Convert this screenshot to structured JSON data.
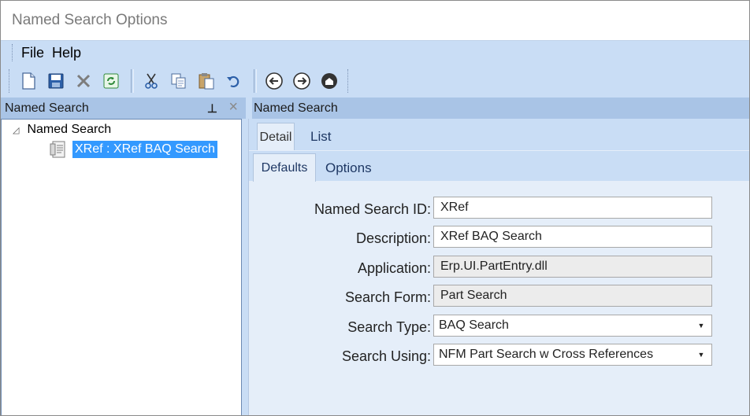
{
  "window": {
    "title": "Named Search Options"
  },
  "menu": {
    "file": "File",
    "help": "Help"
  },
  "toolbar": {
    "buttons": [
      {
        "name": "new",
        "icon": "new-document-icon"
      },
      {
        "name": "save",
        "icon": "save-icon"
      },
      {
        "name": "delete",
        "icon": "delete-x-icon"
      },
      {
        "name": "refresh",
        "icon": "refresh-icon"
      },
      {
        "name": "cut",
        "icon": "scissors-icon"
      },
      {
        "name": "copy",
        "icon": "copy-icon"
      },
      {
        "name": "paste",
        "icon": "paste-icon"
      },
      {
        "name": "undo",
        "icon": "undo-icon"
      },
      {
        "name": "back",
        "icon": "arrow-left-icon"
      },
      {
        "name": "forward",
        "icon": "arrow-right-icon"
      },
      {
        "name": "home",
        "icon": "home-icon"
      }
    ]
  },
  "left_panel": {
    "title": "Named Search",
    "tree": {
      "root_label": "Named Search",
      "child_label": "XRef : XRef BAQ Search"
    }
  },
  "right_panel": {
    "title": "Named Search",
    "tabs": {
      "detail": "Detail",
      "list": "List"
    },
    "subtabs": {
      "defaults": "Defaults",
      "options": "Options"
    },
    "form": {
      "named_search_id_label": "Named Search ID:",
      "named_search_id_value": "XRef",
      "description_label": "Description:",
      "description_value": "XRef BAQ Search",
      "application_label": "Application:",
      "application_value": "Erp.UI.PartEntry.dll",
      "search_form_label": "Search Form:",
      "search_form_value": "Part Search",
      "search_type_label": "Search Type:",
      "search_type_value": "BAQ Search",
      "search_using_label": "Search Using:",
      "search_using_value": "NFM Part Search w Cross References"
    }
  },
  "colors": {
    "chrome": "#c9ddf5",
    "panel_header": "#a9c4e6",
    "selection": "#3399ff",
    "form_bg": "#e5eef9"
  }
}
